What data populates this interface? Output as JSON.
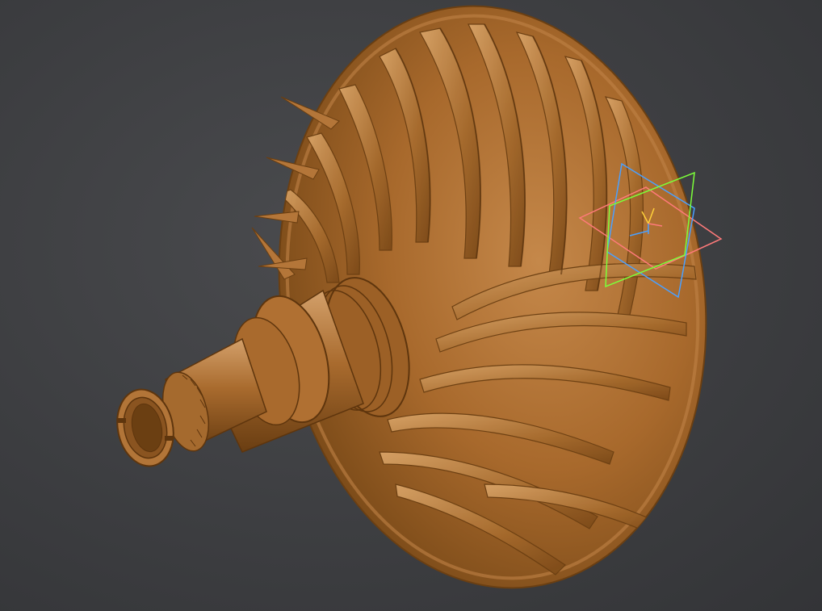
{
  "viewport": {
    "background": "#3f4043",
    "model_color": "#a86a2c",
    "model_shadow": "#6b3f12",
    "model_highlight": "#d39a5a",
    "model_name_icon": "turbocharger-impeller-rotor"
  },
  "gizmo": {
    "plane_xy_color": "#4aa0ff",
    "plane_yz_color": "#7cff3a",
    "plane_xz_color": "#ff7a7a",
    "axis_label_glyph": "y-axis-icon"
  }
}
